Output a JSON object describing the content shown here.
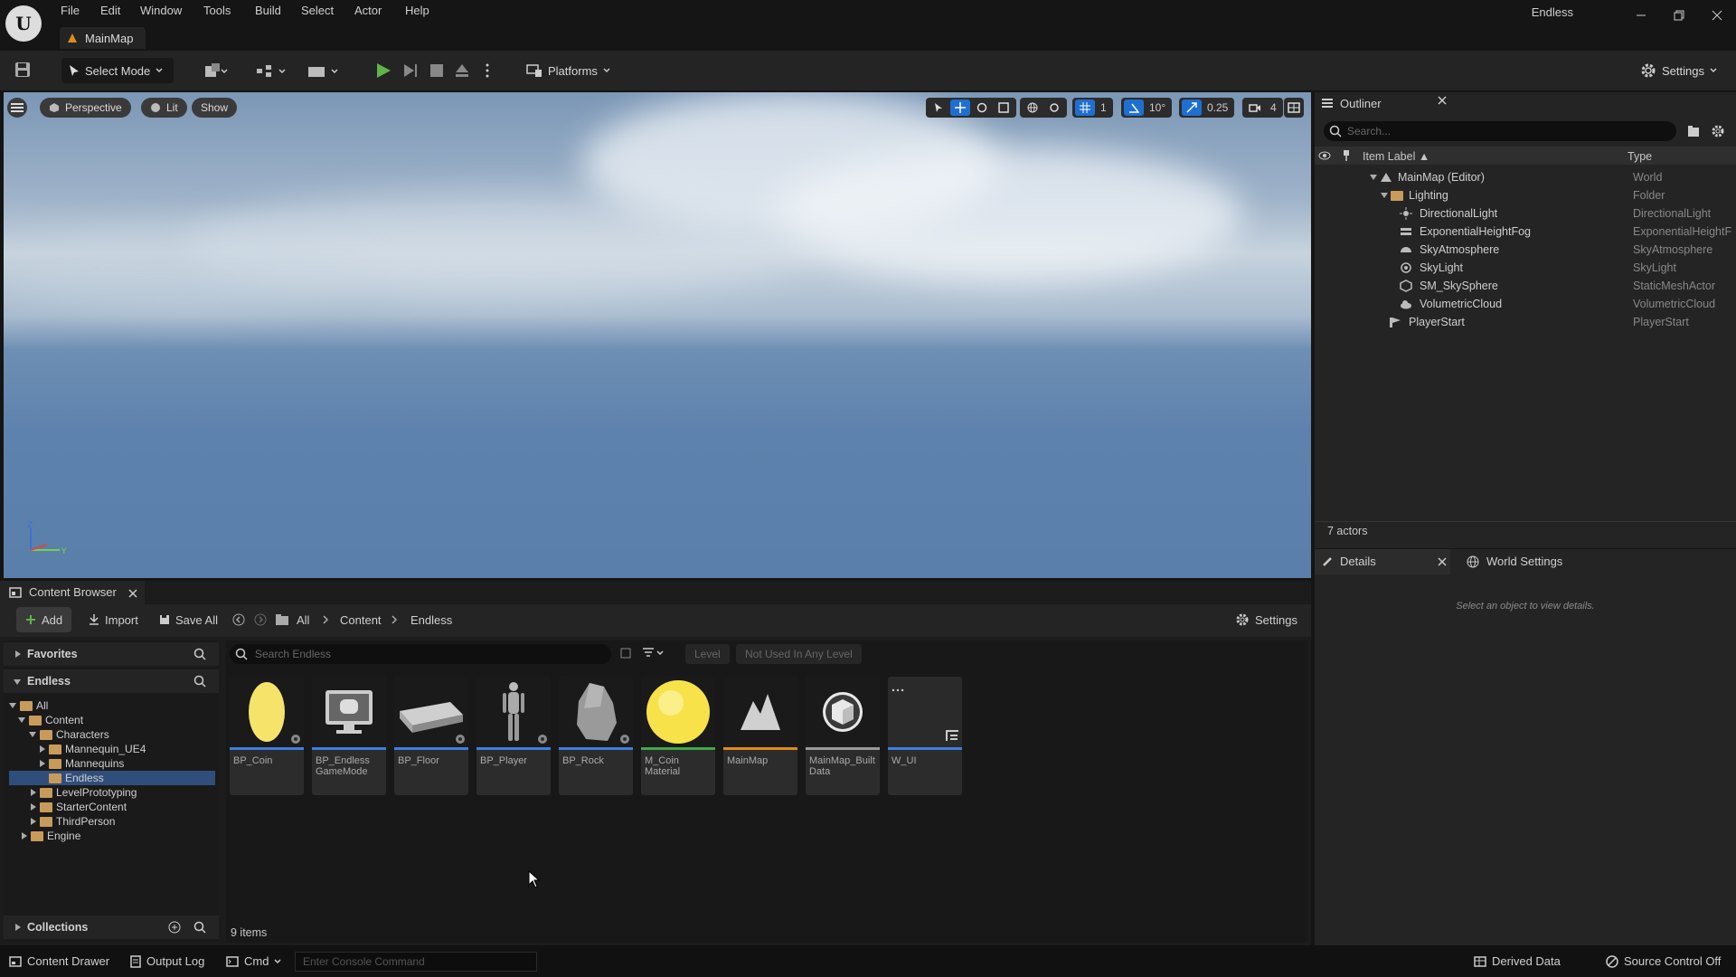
{
  "menu": [
    "File",
    "Edit",
    "Window",
    "Tools",
    "Build",
    "Select",
    "Actor",
    "Help"
  ],
  "project_name": "Endless",
  "doc_tab": "MainMap",
  "toolbar": {
    "select_mode": "Select Mode",
    "platforms": "Platforms",
    "settings": "Settings"
  },
  "viewport": {
    "perspective": "Perspective",
    "lit": "Lit",
    "show": "Show",
    "grid_snap": "1",
    "rot_snap": "10°",
    "scale_snap": "0.25",
    "cam_speed": "4"
  },
  "outliner": {
    "title": "Outliner",
    "search_placeholder": "Search...",
    "col_label": "Item Label ▲",
    "col_type": "Type",
    "rows": [
      {
        "label": "MainMap (Editor)",
        "type": "World"
      },
      {
        "label": "Lighting",
        "type": "Folder"
      },
      {
        "label": "DirectionalLight",
        "type": "DirectionalLight"
      },
      {
        "label": "ExponentialHeightFog",
        "type": "ExponentialHeightF"
      },
      {
        "label": "SkyAtmosphere",
        "type": "SkyAtmosphere"
      },
      {
        "label": "SkyLight",
        "type": "SkyLight"
      },
      {
        "label": "SM_SkySphere",
        "type": "StaticMeshActor"
      },
      {
        "label": "VolumetricCloud",
        "type": "VolumetricCloud"
      },
      {
        "label": "PlayerStart",
        "type": "PlayerStart"
      }
    ],
    "count": "7 actors"
  },
  "details": {
    "tab": "Details",
    "world_settings": "World Settings",
    "empty": "Select an object to view details."
  },
  "content_browser": {
    "title": "Content Browser",
    "add": "Add",
    "import": "Import",
    "save_all": "Save All",
    "breadcrumb": [
      "All",
      "Content",
      "Endless"
    ],
    "settings": "Settings",
    "favorites": "Favorites",
    "endless": "Endless",
    "search_placeholder": "Search Endless",
    "filter_level": "Level",
    "filter_unused": "Not Used In Any Level",
    "tree": [
      "All",
      "Content",
      "Characters",
      "Mannequin_UE4",
      "Mannequins",
      "Endless",
      "LevelPrototyping",
      "StarterContent",
      "ThirdPerson",
      "Engine"
    ],
    "assets": [
      {
        "name": "BP_Coin",
        "color": "#3f7fdd"
      },
      {
        "name": "BP_Endless GameMode",
        "color": "#3f7fdd"
      },
      {
        "name": "BP_Floor",
        "color": "#3f7fdd"
      },
      {
        "name": "BP_Player",
        "color": "#3f7fdd"
      },
      {
        "name": "BP_Rock",
        "color": "#3f7fdd"
      },
      {
        "name": "M_Coin Material",
        "color": "#3fa84a"
      },
      {
        "name": "MainMap",
        "color": "#e08a1e"
      },
      {
        "name": "MainMap_Built Data",
        "color": "#9a9a9a"
      },
      {
        "name": "W_UI",
        "color": "#3f7fdd"
      }
    ],
    "collections": "Collections",
    "item_count": "9 items"
  },
  "status": {
    "content_drawer": "Content Drawer",
    "output_log": "Output Log",
    "cmd": "Cmd",
    "console_placeholder": "Enter Console Command",
    "derived_data": "Derived Data",
    "source_control": "Source Control Off"
  }
}
